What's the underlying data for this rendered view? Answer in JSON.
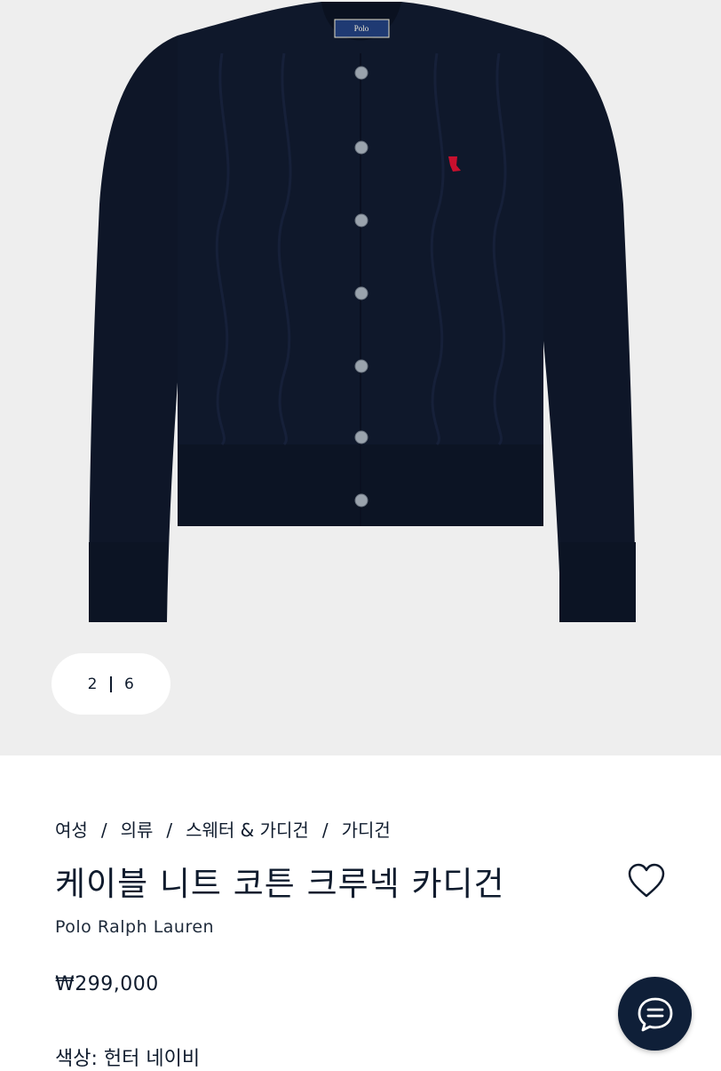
{
  "gallery": {
    "current": "2",
    "total": "6",
    "image_alt": "케이블 니트 코튼 크루넥 카디건",
    "label_brand": "Polo"
  },
  "breadcrumb": {
    "items": [
      "여성",
      "의류",
      "스웨터 & 가디건",
      "가디건"
    ],
    "separator": "/"
  },
  "product": {
    "title": "케이블 니트 코튼 크루넥 카디건",
    "brand": "Polo Ralph Lauren",
    "price": "₩299,000",
    "color_label": "색상:",
    "color_value": "헌터 네이비"
  },
  "icons": {
    "wishlist": "heart-icon",
    "chat": "chat-icon"
  },
  "colors": {
    "navy": "#0f1b2d",
    "chat_bg": "#0f1f38",
    "gallery_bg": "#eeeeee",
    "logo_red": "#c8102e"
  }
}
